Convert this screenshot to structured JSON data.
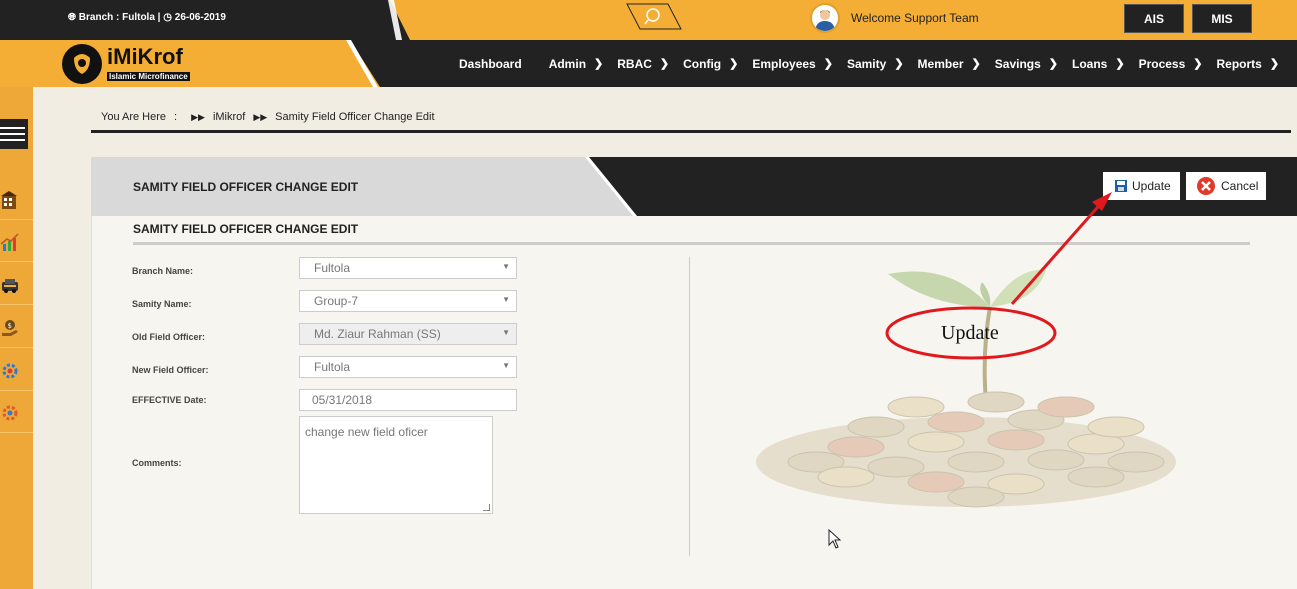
{
  "topbar": {
    "branch_label": "Branch : Fultola |",
    "date": "26-06-2019",
    "welcome": "Welcome Support Team",
    "ais": "AIS",
    "mis": "MIS"
  },
  "logo": {
    "title": "iMiKrof",
    "subtitle": "Islamic Microfinance"
  },
  "nav": {
    "items": [
      {
        "label": "Dashboard",
        "has_menu": false
      },
      {
        "label": "Admin",
        "has_menu": true
      },
      {
        "label": "RBAC",
        "has_menu": true
      },
      {
        "label": "Config",
        "has_menu": true
      },
      {
        "label": "Employees",
        "has_menu": true
      },
      {
        "label": "Samity",
        "has_menu": true
      },
      {
        "label": "Member",
        "has_menu": true
      },
      {
        "label": "Savings",
        "has_menu": true
      },
      {
        "label": "Loans",
        "has_menu": true
      },
      {
        "label": "Process",
        "has_menu": true
      },
      {
        "label": "Reports",
        "has_menu": true
      }
    ]
  },
  "sidebar_icons": [
    "building-icon",
    "chart-icon",
    "car-icon",
    "money-hand-icon",
    "gear-people-icon",
    "settings-icon"
  ],
  "breadcrumb": {
    "prefix": "You Are Here",
    "colon": ":",
    "home": "iMikrof",
    "current": "Samity Field Officer Change Edit"
  },
  "panel": {
    "title": "SAMITY FIELD OFFICER CHANGE EDIT",
    "update_label": "Update",
    "cancel_label": "Cancel",
    "section_title": "SAMITY FIELD OFFICER CHANGE EDIT"
  },
  "form": {
    "branch_label": "Branch Name:",
    "branch_value": "Fultola",
    "samity_label": "Samity Name:",
    "samity_value": "Group-7",
    "old_officer_label": "Old Field Officer:",
    "old_officer_value": "Md. Ziaur Rahman (SS)",
    "new_officer_label": "New Field Officer:",
    "new_officer_value": "Fultola",
    "effective_label": "EFFECTIVE Date:",
    "effective_value": "05/31/2018",
    "comments_label": "Comments:",
    "comments_value": "change new field oficer"
  },
  "annotation": {
    "text": "Update"
  },
  "colors": {
    "accent": "#f4ae35",
    "dark": "#222222",
    "annotation_red": "#e0191f"
  }
}
